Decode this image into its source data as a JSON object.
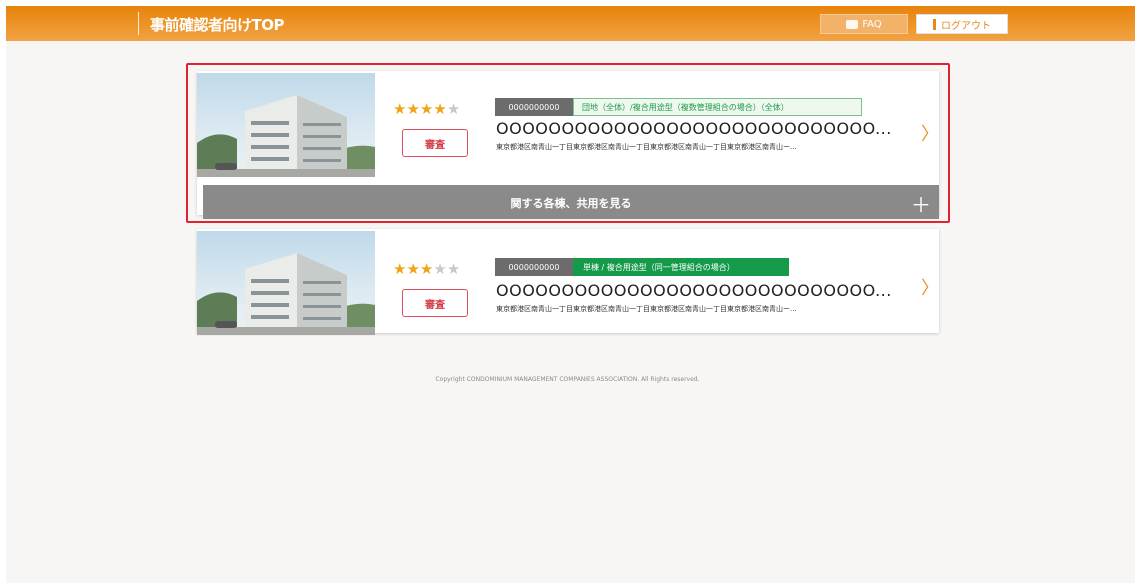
{
  "header": {
    "title": "事前確認者向けTOP",
    "faq_label": "FAQ",
    "logout_label": "ログアウト"
  },
  "cards": [
    {
      "stars_filled": 4,
      "stars_total": 5,
      "badge": "審査",
      "code": "0000000000",
      "type": "団地（全体）/複合用途型（複数管理組合の場合）（全体）",
      "name": "OOOOOOOOOOOOOOOOOOOOOOOOOOOOO...",
      "address": "東京都港区南青山一丁目東京都港区南青山一丁目東京都港区南青山一丁目東京都港区南青山ー...",
      "expand_label": "関する各棟、共用を見る"
    },
    {
      "stars_filled": 3,
      "stars_total": 5,
      "badge": "審査",
      "code": "0000000000",
      "type": "単棟 / 複合用途型（同一管理組合の場合）",
      "name": "OOOOOOOOOOOOOOOOOOOOOOOOOOOOO...",
      "address": "東京都港区南青山一丁目東京都港区南青山一丁目東京都港区南青山一丁目東京都港区南青山ー..."
    }
  ],
  "footer": {
    "copyright": "Copyright CONDOMINIUM MANAGEMENT COMPANIES ASSOCIATION. All Rights reserved."
  },
  "colors": {
    "header": "#ee9426",
    "accent_green": "#159a4a",
    "highlight_red": "#e1222f"
  },
  "icons": {
    "faq": "chat-icon",
    "logout": "logout-icon",
    "card_arrow": "chevron-right-icon",
    "expand": "plus-icon"
  }
}
